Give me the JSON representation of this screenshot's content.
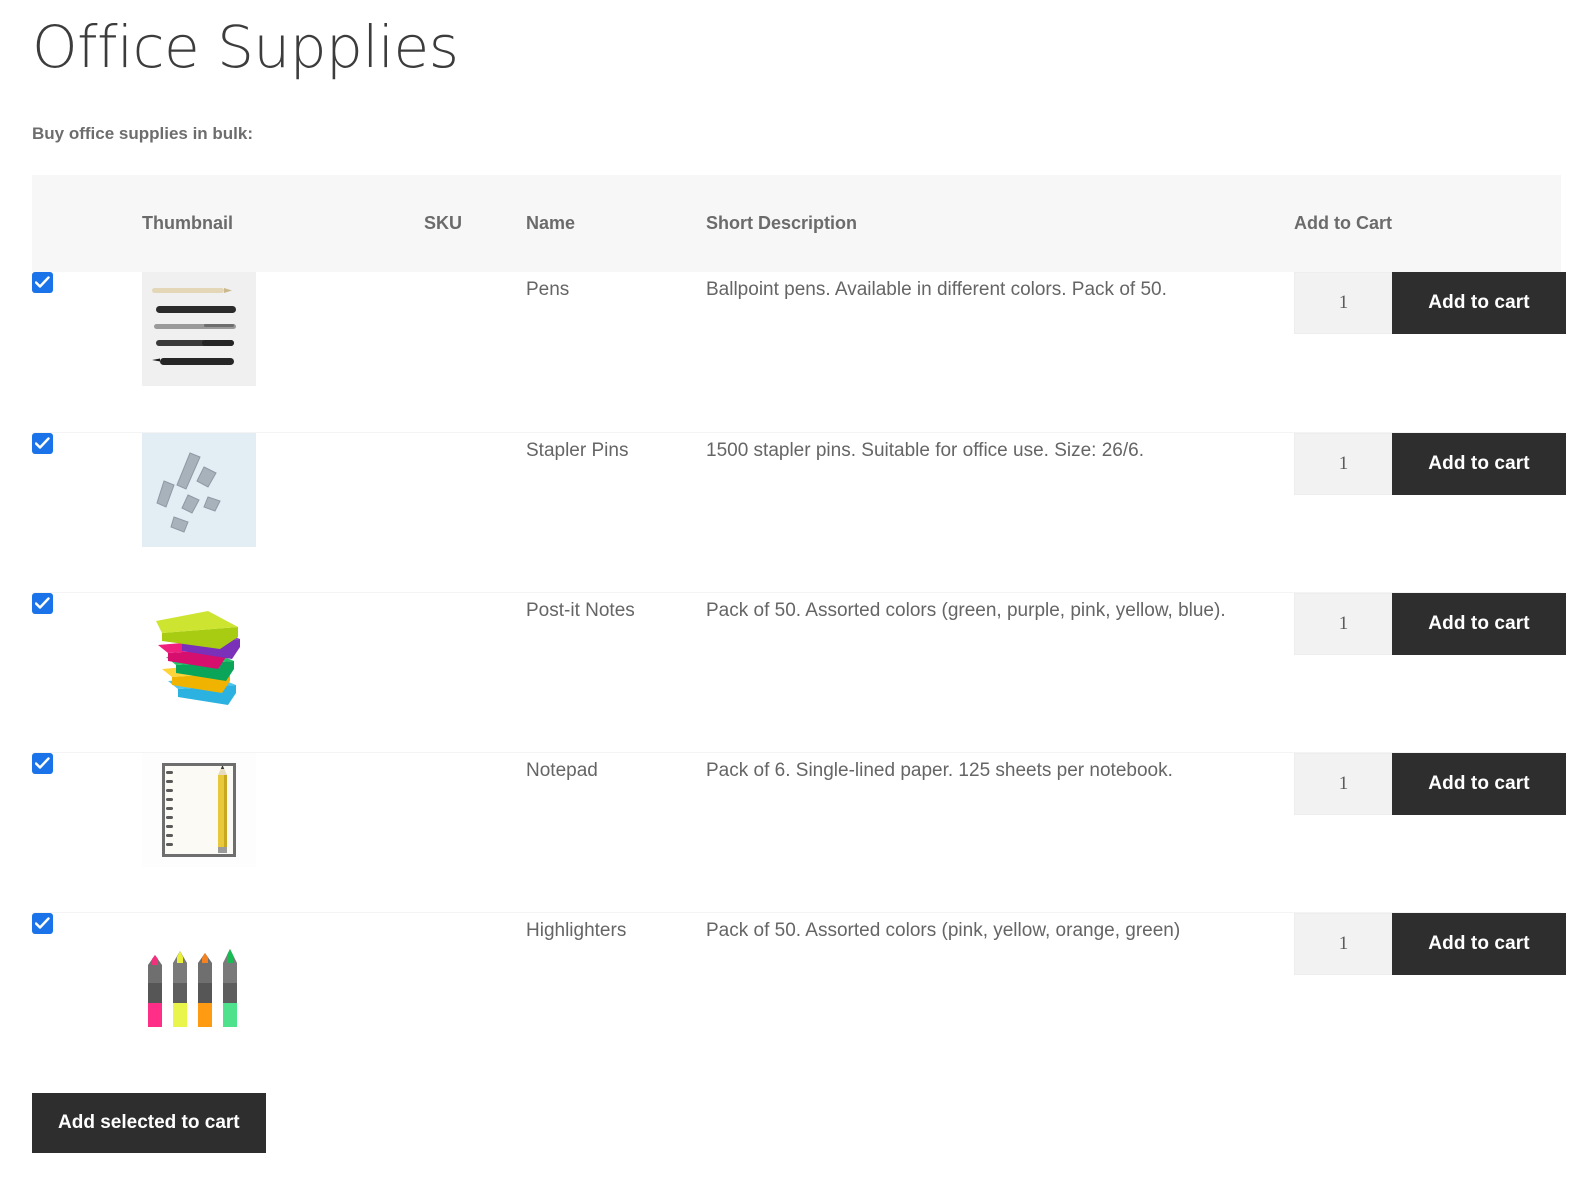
{
  "page": {
    "title": "Office Supplies",
    "subtitle": "Buy office supplies in bulk:"
  },
  "table": {
    "columns": {
      "select": "",
      "thumbnail": "Thumbnail",
      "sku": "SKU",
      "name": "Name",
      "short_description": "Short Description",
      "add_to_cart": "Add to Cart"
    },
    "rows": [
      {
        "selected": true,
        "thumbnail_icon": "pens-photo",
        "sku": "",
        "name": "Pens",
        "short_description": "Ballpoint pens. Available in different colors. Pack of 50.",
        "quantity": "1",
        "add_label": "Add to cart"
      },
      {
        "selected": true,
        "thumbnail_icon": "stapler-pins-photo",
        "sku": "",
        "name": "Stapler Pins",
        "short_description": "1500 stapler pins. Suitable for office use. Size: 26/6.",
        "quantity": "1",
        "add_label": "Add to cart"
      },
      {
        "selected": true,
        "thumbnail_icon": "post-it-notes-photo",
        "sku": "",
        "name": "Post-it Notes",
        "short_description": "Pack of 50. Assorted colors (green, purple, pink, yellow, blue).",
        "quantity": "1",
        "add_label": "Add to cart"
      },
      {
        "selected": true,
        "thumbnail_icon": "notepad-photo",
        "sku": "",
        "name": "Notepad",
        "short_description": "Pack of 6. Single-lined paper. 125 sheets per notebook.",
        "quantity": "1",
        "add_label": "Add to cart"
      },
      {
        "selected": true,
        "thumbnail_icon": "highlighters-photo",
        "sku": "",
        "name": "Highlighters",
        "short_description": "Pack of 50. Assorted colors (pink, yellow, orange, green)",
        "quantity": "1",
        "add_label": "Add to cart"
      }
    ]
  },
  "bulk_action": {
    "label": "Add selected to cart"
  },
  "colors": {
    "checkbox_blue": "#1a73e8",
    "button_dark": "#2e2e2e",
    "header_bg": "#f7f7f7",
    "text_gray": "#656565"
  }
}
